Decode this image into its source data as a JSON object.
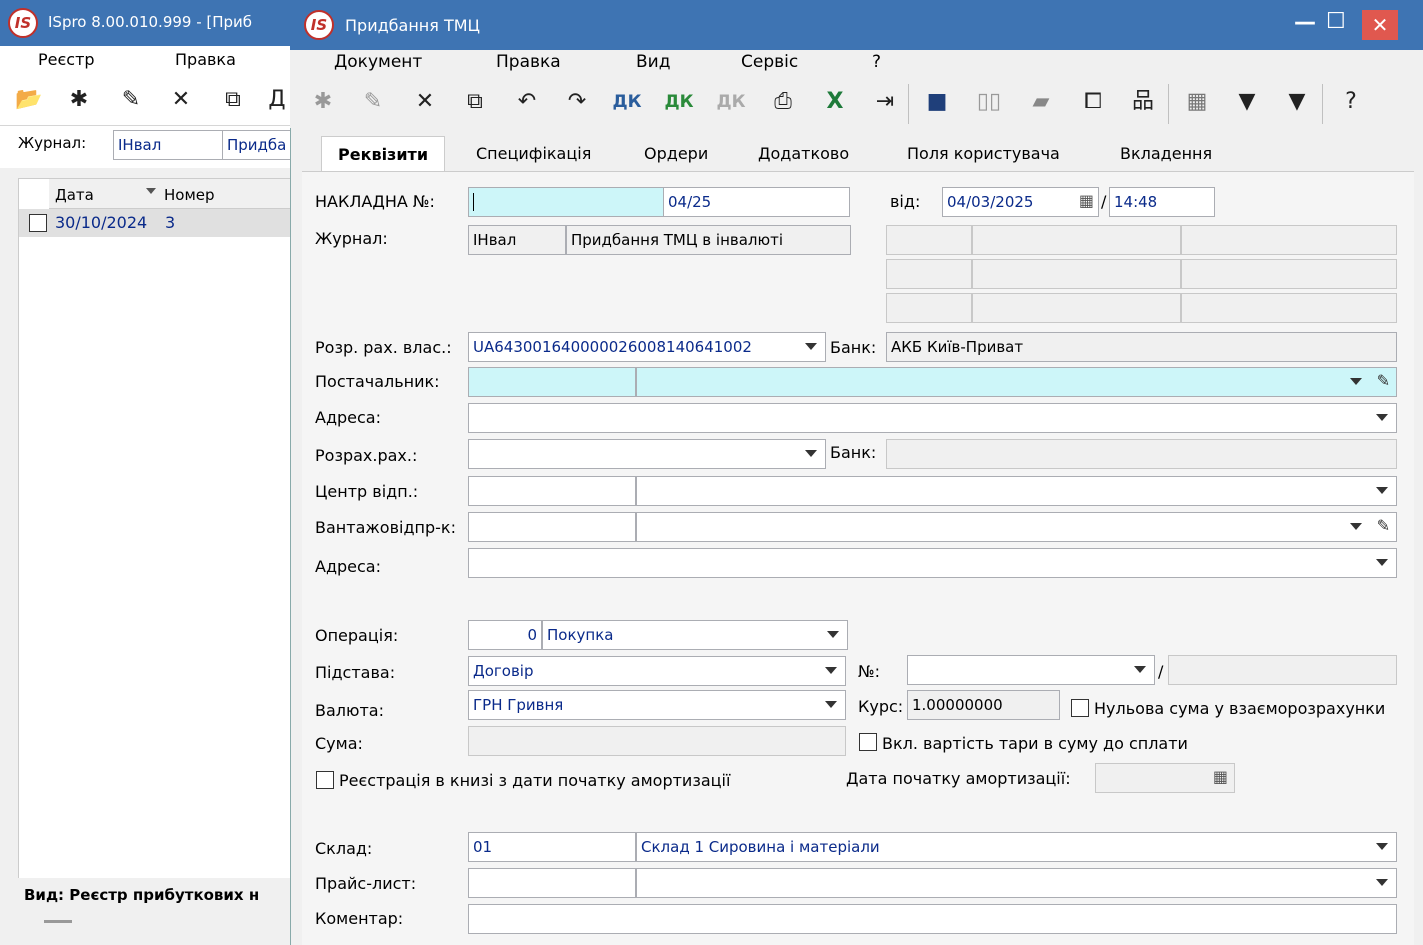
{
  "bg_window": {
    "title": "ISpro 8.00.010.999 - [Приб",
    "logo": "IS",
    "menu": [
      "Реєстр",
      "Правка"
    ],
    "journal_label": "Журнал:",
    "journal_code": "ІНвал",
    "journal_name": "Придба",
    "columns": [
      "Дата",
      "Номер"
    ],
    "rows": [
      {
        "date": "30/10/2024",
        "number": "3"
      }
    ],
    "footer": "Вид: Реєстр прибуткових н"
  },
  "window": {
    "title": "Придбання ТМЦ",
    "logo": "IS",
    "minimize": "—",
    "maximize": "☐",
    "close": "✕"
  },
  "menu": [
    "Документ",
    "Правка",
    "Вид",
    "Сервіс",
    "?"
  ],
  "tabs": [
    "Реквізити",
    "Специфікація",
    "Ордери",
    "Додатково",
    "Поля користувача",
    "Вкладення"
  ],
  "form": {
    "invoice_label": "НАКЛАДНА №:",
    "invoice_prefix": "",
    "invoice_number": "04/25",
    "from_label": "від:",
    "date": "04/03/2025",
    "time": "14:48",
    "journal_label": "Журнал:",
    "journal_code": "ІНвал",
    "journal_name": "Придбання ТМЦ в інвалюті",
    "own_account_label": "Розр. рах. влас.:",
    "own_account": "UA643001640000026008140641002",
    "bank_label": "Банк:",
    "bank": "АКБ Київ-Приват",
    "supplier_label": "Постачальник:",
    "address_label": "Адреса:",
    "account_label": "Розрах.рах.:",
    "bank2_label": "Банк:",
    "center_label": "Центр відп.:",
    "shipper_label": "Вантажовідпр-к:",
    "address2_label": "Адреса:",
    "operation_label": "Операція:",
    "operation_code": "0",
    "operation_name": "Покупка",
    "basis_label": "Підстава:",
    "basis": "Договір",
    "number_label": "№:",
    "currency_label": "Валюта:",
    "currency": "ГРН Гривня",
    "rate_label": "Курс:",
    "rate": "1.00000000",
    "zero_sum_label": "Нульова сума у взаєморозрахунки",
    "sum_label": "Сума:",
    "tare_label": "Вкл. вартість тари в суму до сплати",
    "registration_label": "Реєстрація в книзі з дати початку амортизації",
    "amort_date_label": "Дата початку амортизації:",
    "warehouse_label": "Склад:",
    "warehouse_code": "01",
    "warehouse_name": "Склад 1 Сировина і матеріали",
    "price_list_label": "Прайс-лист:",
    "comment_label": "Коментар:"
  },
  "colors": {
    "titlebar": "#3e74b3",
    "close": "#e0584f",
    "field_cyan": "#cdf6f9",
    "value_text": "#0a2a8a"
  }
}
